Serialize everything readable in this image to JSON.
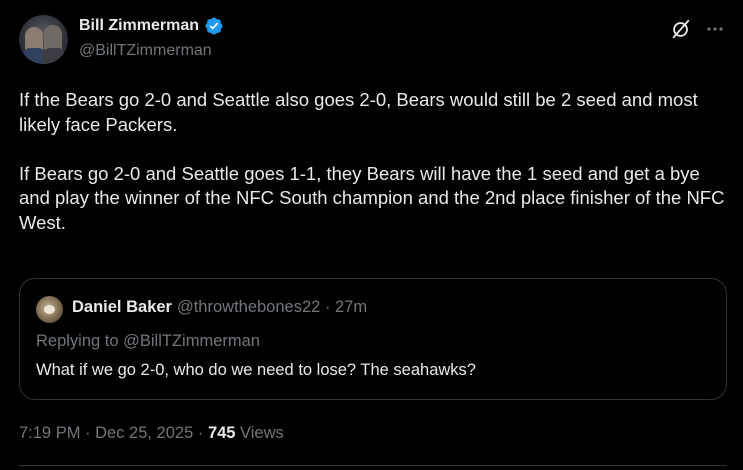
{
  "author": {
    "display_name": "Bill Zimmerman",
    "handle": "@BillTZimmerman",
    "verified": true
  },
  "tweet": {
    "paragraphs": [
      "If the Bears go 2-0 and Seattle also goes 2-0, Bears would still be 2 seed and most likely face Packers.",
      "If Bears go 2-0 and Seattle goes 1-1, they Bears will have the 1 seed and get a bye and play the winner of the NFC South champion and the 2nd place finisher of the NFC West."
    ],
    "timestamp": "7:19 PM · Dec 25, 2025 · ",
    "views_count": "745",
    "views_label": " Views"
  },
  "quoted": {
    "name": "Daniel Baker",
    "meta": "@throwthebones22 · 27m",
    "replying_to": "Replying to @BillTZimmerman",
    "text": "What if we go 2-0, who do we need to lose? The seahawks?"
  },
  "icons": {
    "verified": "verified-badge-icon",
    "grok": "grok-icon",
    "more": "more-options-icon"
  },
  "colors": {
    "background": "#000000",
    "text": "#e7e9ea",
    "muted": "#71767b",
    "verified": "#1d9bf0",
    "border": "#2f3336"
  }
}
